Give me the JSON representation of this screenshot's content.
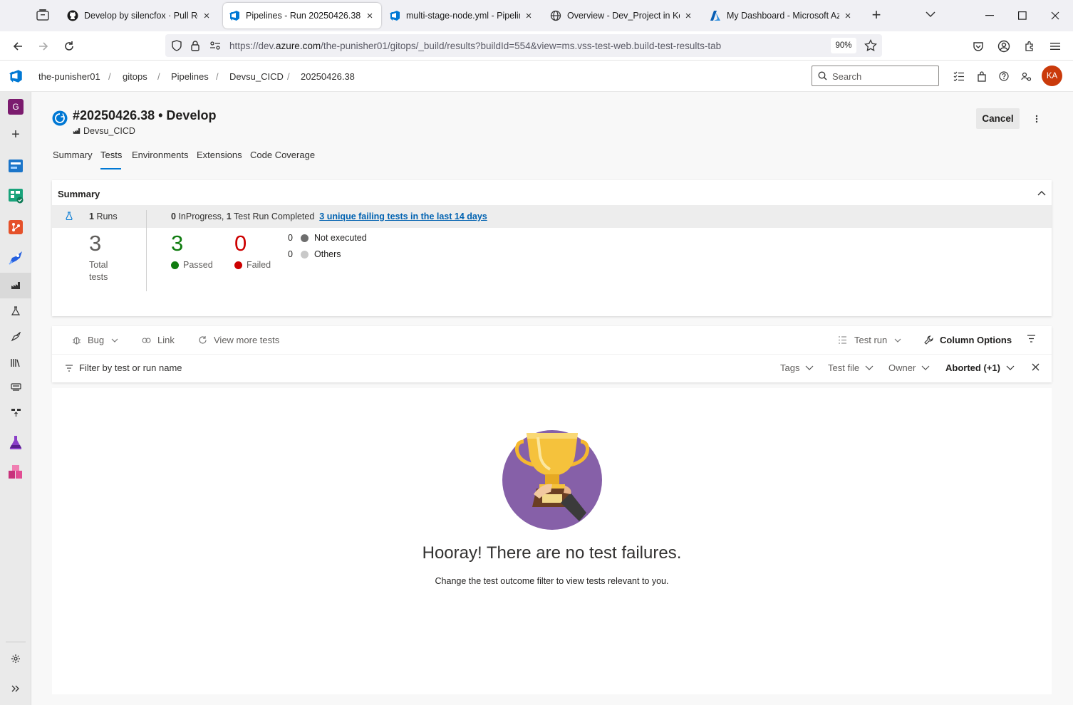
{
  "browser": {
    "tabs": [
      {
        "label": "Develop by silencfox · Pull Requ",
        "icon": "github-icon"
      },
      {
        "label": "Pipelines - Run 20250426.38",
        "icon": "azure-devops-icon"
      },
      {
        "label": "multi-stage-node.yml - Pipeline",
        "icon": "azure-devops-icon"
      },
      {
        "label": "Overview - Dev_Project in Kelvir",
        "icon": "globe-icon"
      },
      {
        "label": "My Dashboard - Microsoft Azur",
        "icon": "azure-icon"
      }
    ],
    "url_prefix": "https://dev.",
    "url_domain": "azure.com",
    "url_rest": "/the-punisher01/gitops/_build/results?buildId=554&view=ms.vss-test-web.build-test-results-tab",
    "zoom": "90%"
  },
  "header": {
    "breadcrumbs": [
      "the-punisher01",
      "gitops",
      "Pipelines",
      "Devsu_CICD",
      "20250426.38"
    ],
    "search_placeholder": "Search",
    "avatar_initials": "KA",
    "rail_badge": "G"
  },
  "run": {
    "title": "#20250426.38 • Develop",
    "pipeline": "Devsu_CICD",
    "cancel_label": "Cancel"
  },
  "pivots": [
    "Summary",
    "Tests",
    "Environments",
    "Extensions",
    "Code Coverage"
  ],
  "summary": {
    "title": "Summary",
    "runs_count": "1",
    "runs_label": "Runs",
    "inprogress_count": "0",
    "inprogress_text": "InProgress,",
    "completed_count": "1",
    "completed_text": "Test Run Completed",
    "failing_link": "3 unique failing tests in the last 14 days",
    "total": "3",
    "total_label_1": "Total",
    "total_label_2": "tests",
    "passed": "3",
    "passed_label": "Passed",
    "failed": "0",
    "failed_label": "Failed",
    "not_executed_count": "0",
    "not_executed_label": "Not executed",
    "others_count": "0",
    "others_label": "Others",
    "colors": {
      "passed": "#107c10",
      "failed": "#cd0000",
      "not_executed": "#6e6e6e",
      "others": "#c8c8c8"
    }
  },
  "toolbar": {
    "bug": "Bug",
    "link": "Link",
    "view_more": "View more tests",
    "test_run": "Test run",
    "column_options": "Column Options",
    "filter_placeholder": "Filter by test or run name",
    "tags": "Tags",
    "test_file": "Test file",
    "owner": "Owner",
    "outcome": "Aborted (+1)"
  },
  "empty": {
    "title": "Hooray! There are no test failures.",
    "subtitle": "Change the test outcome filter to view tests relevant to you."
  },
  "accent": "#0078d4"
}
